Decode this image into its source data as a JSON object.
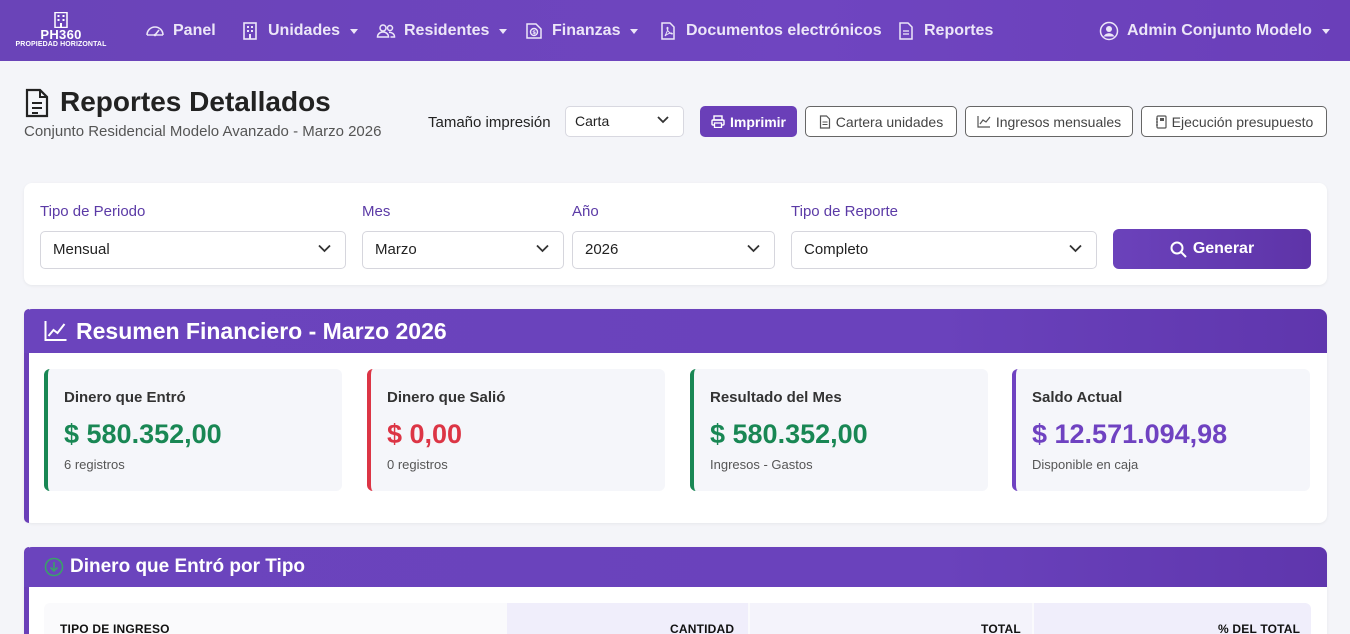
{
  "brand": {
    "name": "PH360",
    "tagline": "PROPIEDAD HORIZONTAL"
  },
  "nav": {
    "items": [
      {
        "label": "Panel",
        "icon": "gauge-icon",
        "dropdown": false
      },
      {
        "label": "Unidades",
        "icon": "building-icon",
        "dropdown": true
      },
      {
        "label": "Residentes",
        "icon": "people-icon",
        "dropdown": true
      },
      {
        "label": "Finanzas",
        "icon": "cash-icon",
        "dropdown": true
      },
      {
        "label": "Documentos electrónicos",
        "icon": "pdf-file-icon",
        "dropdown": false
      },
      {
        "label": "Reportes",
        "icon": "file-text-icon",
        "dropdown": false
      }
    ],
    "user": {
      "label": "Admin Conjunto Modelo",
      "icon": "user-circle-icon"
    }
  },
  "header": {
    "title": "Reportes Detallados",
    "subtitle": "Conjunto Residencial Modelo Avanzado - Marzo 2026",
    "print_size_label": "Tamaño impresión",
    "print_size_value": "Carta",
    "print_button": "Imprimir",
    "buttons": [
      "Cartera unidades",
      "Ingresos mensuales",
      "Ejecución presupuesto"
    ]
  },
  "filters": {
    "period_type": {
      "label": "Tipo de Periodo",
      "value": "Mensual"
    },
    "month": {
      "label": "Mes",
      "value": "Marzo"
    },
    "year": {
      "label": "Año",
      "value": "2026"
    },
    "report_type": {
      "label": "Tipo de Reporte",
      "value": "Completo"
    },
    "generate_button": "Generar"
  },
  "summary": {
    "title": "Resumen Financiero - Marzo 2026",
    "cards": [
      {
        "title": "Dinero que Entró",
        "value": "$ 580.352,00",
        "note": "6 registros",
        "color": "#198754"
      },
      {
        "title": "Dinero que Salió",
        "value": "$ 0,00",
        "note": "0 registros",
        "color": "#dc3545"
      },
      {
        "title": "Resultado del Mes",
        "value": "$ 580.352,00",
        "note": "Ingresos - Gastos",
        "color": "#198754"
      },
      {
        "title": "Saldo Actual",
        "value": "$ 12.571.094,98",
        "note": "Disponible en caja",
        "color": "#6f42c1"
      }
    ]
  },
  "income_by_type": {
    "title": "Dinero que Entró por Tipo",
    "columns": [
      "TIPO DE INGRESO",
      "CANTIDAD",
      "TOTAL",
      "% DEL TOTAL"
    ]
  },
  "colors": {
    "primary": "#6a3fb8",
    "success": "#198754",
    "danger": "#dc3545",
    "purple": "#6f42c1"
  }
}
